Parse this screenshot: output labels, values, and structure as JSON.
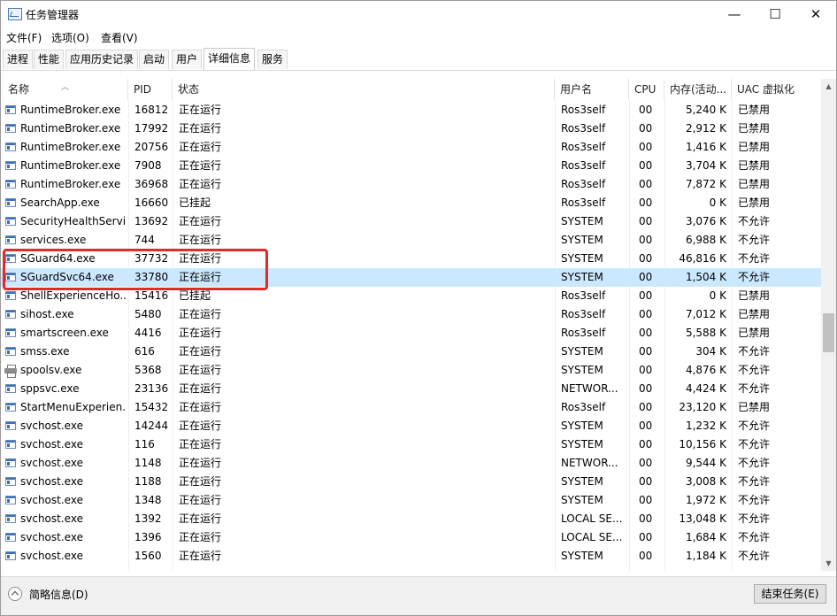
{
  "window": {
    "title": "任务管理器",
    "minimize": "—",
    "maximize": "☐",
    "close": "✕"
  },
  "menu": [
    "文件(F)",
    "选项(O)",
    "查看(V)"
  ],
  "tabs": [
    "进程",
    "性能",
    "应用历史记录",
    "启动",
    "用户",
    "详细信息",
    "服务"
  ],
  "active_tab": "详细信息",
  "columns": [
    "名称",
    "PID",
    "状态",
    "用户名",
    "CPU",
    "内存(活动...",
    "UAC 虚拟化"
  ],
  "rows": [
    {
      "name": "RuntimeBroker.exe",
      "pid": "16812",
      "status": "正在运行",
      "user": "Ros3self",
      "cpu": "00",
      "mem": "5,240 K",
      "uac": "已禁用",
      "icon": "process-icon"
    },
    {
      "name": "RuntimeBroker.exe",
      "pid": "17992",
      "status": "正在运行",
      "user": "Ros3self",
      "cpu": "00",
      "mem": "2,912 K",
      "uac": "已禁用",
      "icon": "process-icon"
    },
    {
      "name": "RuntimeBroker.exe",
      "pid": "20756",
      "status": "正在运行",
      "user": "Ros3self",
      "cpu": "00",
      "mem": "1,416 K",
      "uac": "已禁用",
      "icon": "process-icon"
    },
    {
      "name": "RuntimeBroker.exe",
      "pid": "7908",
      "status": "正在运行",
      "user": "Ros3self",
      "cpu": "00",
      "mem": "3,704 K",
      "uac": "已禁用",
      "icon": "process-icon"
    },
    {
      "name": "RuntimeBroker.exe",
      "pid": "36968",
      "status": "正在运行",
      "user": "Ros3self",
      "cpu": "00",
      "mem": "7,872 K",
      "uac": "已禁用",
      "icon": "process-icon"
    },
    {
      "name": "SearchApp.exe",
      "pid": "16660",
      "status": "已挂起",
      "user": "Ros3self",
      "cpu": "00",
      "mem": "0 K",
      "uac": "已禁用",
      "icon": "process-icon"
    },
    {
      "name": "SecurityHealthServi...",
      "pid": "13692",
      "status": "正在运行",
      "user": "SYSTEM",
      "cpu": "00",
      "mem": "3,076 K",
      "uac": "不允许",
      "icon": "process-icon"
    },
    {
      "name": "services.exe",
      "pid": "744",
      "status": "正在运行",
      "user": "SYSTEM",
      "cpu": "00",
      "mem": "6,988 K",
      "uac": "不允许",
      "icon": "process-icon"
    },
    {
      "name": "SGuard64.exe",
      "pid": "37732",
      "status": "正在运行",
      "user": "SYSTEM",
      "cpu": "00",
      "mem": "46,816 K",
      "uac": "不允许",
      "icon": "process-icon"
    },
    {
      "name": "SGuardSvc64.exe",
      "pid": "33780",
      "status": "正在运行",
      "user": "SYSTEM",
      "cpu": "00",
      "mem": "1,504 K",
      "uac": "不允许",
      "icon": "process-icon",
      "selected": true
    },
    {
      "name": "ShellExperienceHo...",
      "pid": "15416",
      "status": "已挂起",
      "user": "Ros3self",
      "cpu": "00",
      "mem": "0 K",
      "uac": "已禁用",
      "icon": "process-icon"
    },
    {
      "name": "sihost.exe",
      "pid": "5480",
      "status": "正在运行",
      "user": "Ros3self",
      "cpu": "00",
      "mem": "7,012 K",
      "uac": "已禁用",
      "icon": "process-icon"
    },
    {
      "name": "smartscreen.exe",
      "pid": "4416",
      "status": "正在运行",
      "user": "Ros3self",
      "cpu": "00",
      "mem": "5,588 K",
      "uac": "已禁用",
      "icon": "process-icon"
    },
    {
      "name": "smss.exe",
      "pid": "616",
      "status": "正在运行",
      "user": "SYSTEM",
      "cpu": "00",
      "mem": "304 K",
      "uac": "不允许",
      "icon": "process-icon"
    },
    {
      "name": "spoolsv.exe",
      "pid": "5368",
      "status": "正在运行",
      "user": "SYSTEM",
      "cpu": "00",
      "mem": "4,876 K",
      "uac": "不允许",
      "icon": "printer-icon"
    },
    {
      "name": "sppsvc.exe",
      "pid": "23136",
      "status": "正在运行",
      "user": "NETWOR...",
      "cpu": "00",
      "mem": "4,424 K",
      "uac": "不允许",
      "icon": "process-icon"
    },
    {
      "name": "StartMenuExperien...",
      "pid": "15432",
      "status": "正在运行",
      "user": "Ros3self",
      "cpu": "00",
      "mem": "23,120 K",
      "uac": "已禁用",
      "icon": "process-icon"
    },
    {
      "name": "svchost.exe",
      "pid": "14244",
      "status": "正在运行",
      "user": "SYSTEM",
      "cpu": "00",
      "mem": "1,232 K",
      "uac": "不允许",
      "icon": "process-icon"
    },
    {
      "name": "svchost.exe",
      "pid": "116",
      "status": "正在运行",
      "user": "SYSTEM",
      "cpu": "00",
      "mem": "10,156 K",
      "uac": "不允许",
      "icon": "process-icon"
    },
    {
      "name": "svchost.exe",
      "pid": "1148",
      "status": "正在运行",
      "user": "NETWOR...",
      "cpu": "00",
      "mem": "9,544 K",
      "uac": "不允许",
      "icon": "process-icon"
    },
    {
      "name": "svchost.exe",
      "pid": "1188",
      "status": "正在运行",
      "user": "SYSTEM",
      "cpu": "00",
      "mem": "3,008 K",
      "uac": "不允许",
      "icon": "process-icon"
    },
    {
      "name": "svchost.exe",
      "pid": "1348",
      "status": "正在运行",
      "user": "SYSTEM",
      "cpu": "00",
      "mem": "1,972 K",
      "uac": "不允许",
      "icon": "process-icon"
    },
    {
      "name": "svchost.exe",
      "pid": "1392",
      "status": "正在运行",
      "user": "LOCAL SE...",
      "cpu": "00",
      "mem": "13,048 K",
      "uac": "不允许",
      "icon": "process-icon"
    },
    {
      "name": "svchost.exe",
      "pid": "1396",
      "status": "正在运行",
      "user": "LOCAL SE...",
      "cpu": "00",
      "mem": "1,684 K",
      "uac": "不允许",
      "icon": "process-icon"
    },
    {
      "name": "svchost.exe",
      "pid": "1560",
      "status": "正在运行",
      "user": "SYSTEM",
      "cpu": "00",
      "mem": "1,184 K",
      "uac": "不允许",
      "icon": "process-icon"
    }
  ],
  "footer": {
    "fewer_details": "简略信息(D)",
    "end_task": "结束任务(E)"
  },
  "colors": {
    "selected_row": "#cce8ff",
    "highlight_box": "#e02b2b"
  }
}
